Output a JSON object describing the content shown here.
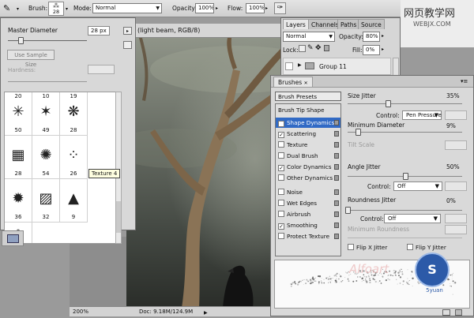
{
  "options_bar": {
    "brush_label": "Brush:",
    "brush_size": "28",
    "mode_label": "Mode:",
    "mode_value": "Normal",
    "opacity_label": "Opacity:",
    "opacity_value": "100%",
    "flow_label": "Flow:",
    "flow_value": "100%"
  },
  "document": {
    "title": "(light beam, RGB/8)",
    "zoom": "200%",
    "doc_info": "Doc: 9.18M/124.9M"
  },
  "brush_picker": {
    "master_diameter_label": "Master Diameter",
    "master_diameter_value": "28 px",
    "use_sample_size": "Use Sample Size",
    "hardness_label": "Hardness:",
    "tooltip": "Texture 4",
    "brushes": [
      {
        "top": "20",
        "bottom": "50",
        "shape": "star"
      },
      {
        "top": "10",
        "bottom": "49",
        "shape": "star2"
      },
      {
        "top": "19",
        "bottom": "28",
        "shape": "splat"
      },
      {
        "top": "",
        "bottom": "28",
        "shape": "grid"
      },
      {
        "top": "",
        "bottom": "54",
        "shape": "blob"
      },
      {
        "top": "",
        "bottom": "26",
        "shape": "dots"
      },
      {
        "top": "",
        "bottom": "36",
        "shape": "scribble"
      },
      {
        "top": "",
        "bottom": "32",
        "shape": "stripe"
      },
      {
        "top": "",
        "bottom": "9",
        "shape": "triangle"
      }
    ]
  },
  "layers_panel": {
    "tabs": [
      "Layers",
      "Channels",
      "Paths",
      "Source"
    ],
    "blend_mode": "Normal",
    "opacity_label": "Opacity:",
    "opacity_value": "80%",
    "lock_label": "Lock:",
    "fill_label": "Fill:",
    "fill_value": "0%",
    "group_name": "Group 11"
  },
  "watermark": {
    "line1": "网页教学网",
    "line2": "WEBJX.COM",
    "overlay_text": "Alfoart",
    "logo_text": "5yuan"
  },
  "brushes_panel": {
    "title": "Brushes",
    "header_item": "Brush Presets",
    "subheader": "Brush Tip Shape",
    "options": [
      {
        "label": "Shape Dynamics",
        "checked": true,
        "selected": true
      },
      {
        "label": "Scattering",
        "checked": true,
        "selected": false
      },
      {
        "label": "Texture",
        "checked": false,
        "selected": false
      },
      {
        "label": "Dual Brush",
        "checked": false,
        "selected": false
      },
      {
        "label": "Color Dynamics",
        "checked": true,
        "selected": false
      },
      {
        "label": "Other Dynamics",
        "checked": false,
        "selected": false
      },
      {
        "label": "Noise",
        "checked": false,
        "selected": false
      },
      {
        "label": "Wet Edges",
        "checked": false,
        "selected": false
      },
      {
        "label": "Airbrush",
        "checked": false,
        "selected": false
      },
      {
        "label": "Smoothing",
        "checked": true,
        "selected": false
      },
      {
        "label": "Protect Texture",
        "checked": false,
        "selected": false
      }
    ],
    "size_jitter_label": "Size Jitter",
    "size_jitter_value": "35%",
    "control_label": "Control:",
    "control1_value": "Pen Pressure",
    "min_diameter_label": "Minimum Diameter",
    "min_diameter_value": "9%",
    "tilt_scale_label": "Tilt Scale",
    "angle_jitter_label": "Angle Jitter",
    "angle_jitter_value": "50%",
    "control2_value": "Off",
    "roundness_jitter_label": "Roundness Jitter",
    "roundness_jitter_value": "0%",
    "control3_value": "Off",
    "min_roundness_label": "Minimum Roundness",
    "flip_x_label": "Flip X Jitter",
    "flip_y_label": "Flip Y Jitter",
    "size_jitter_level": 0.35,
    "min_diameter_level": 0.09,
    "angle_jitter_level": 0.5,
    "roundness_jitter_level": 0.0
  }
}
